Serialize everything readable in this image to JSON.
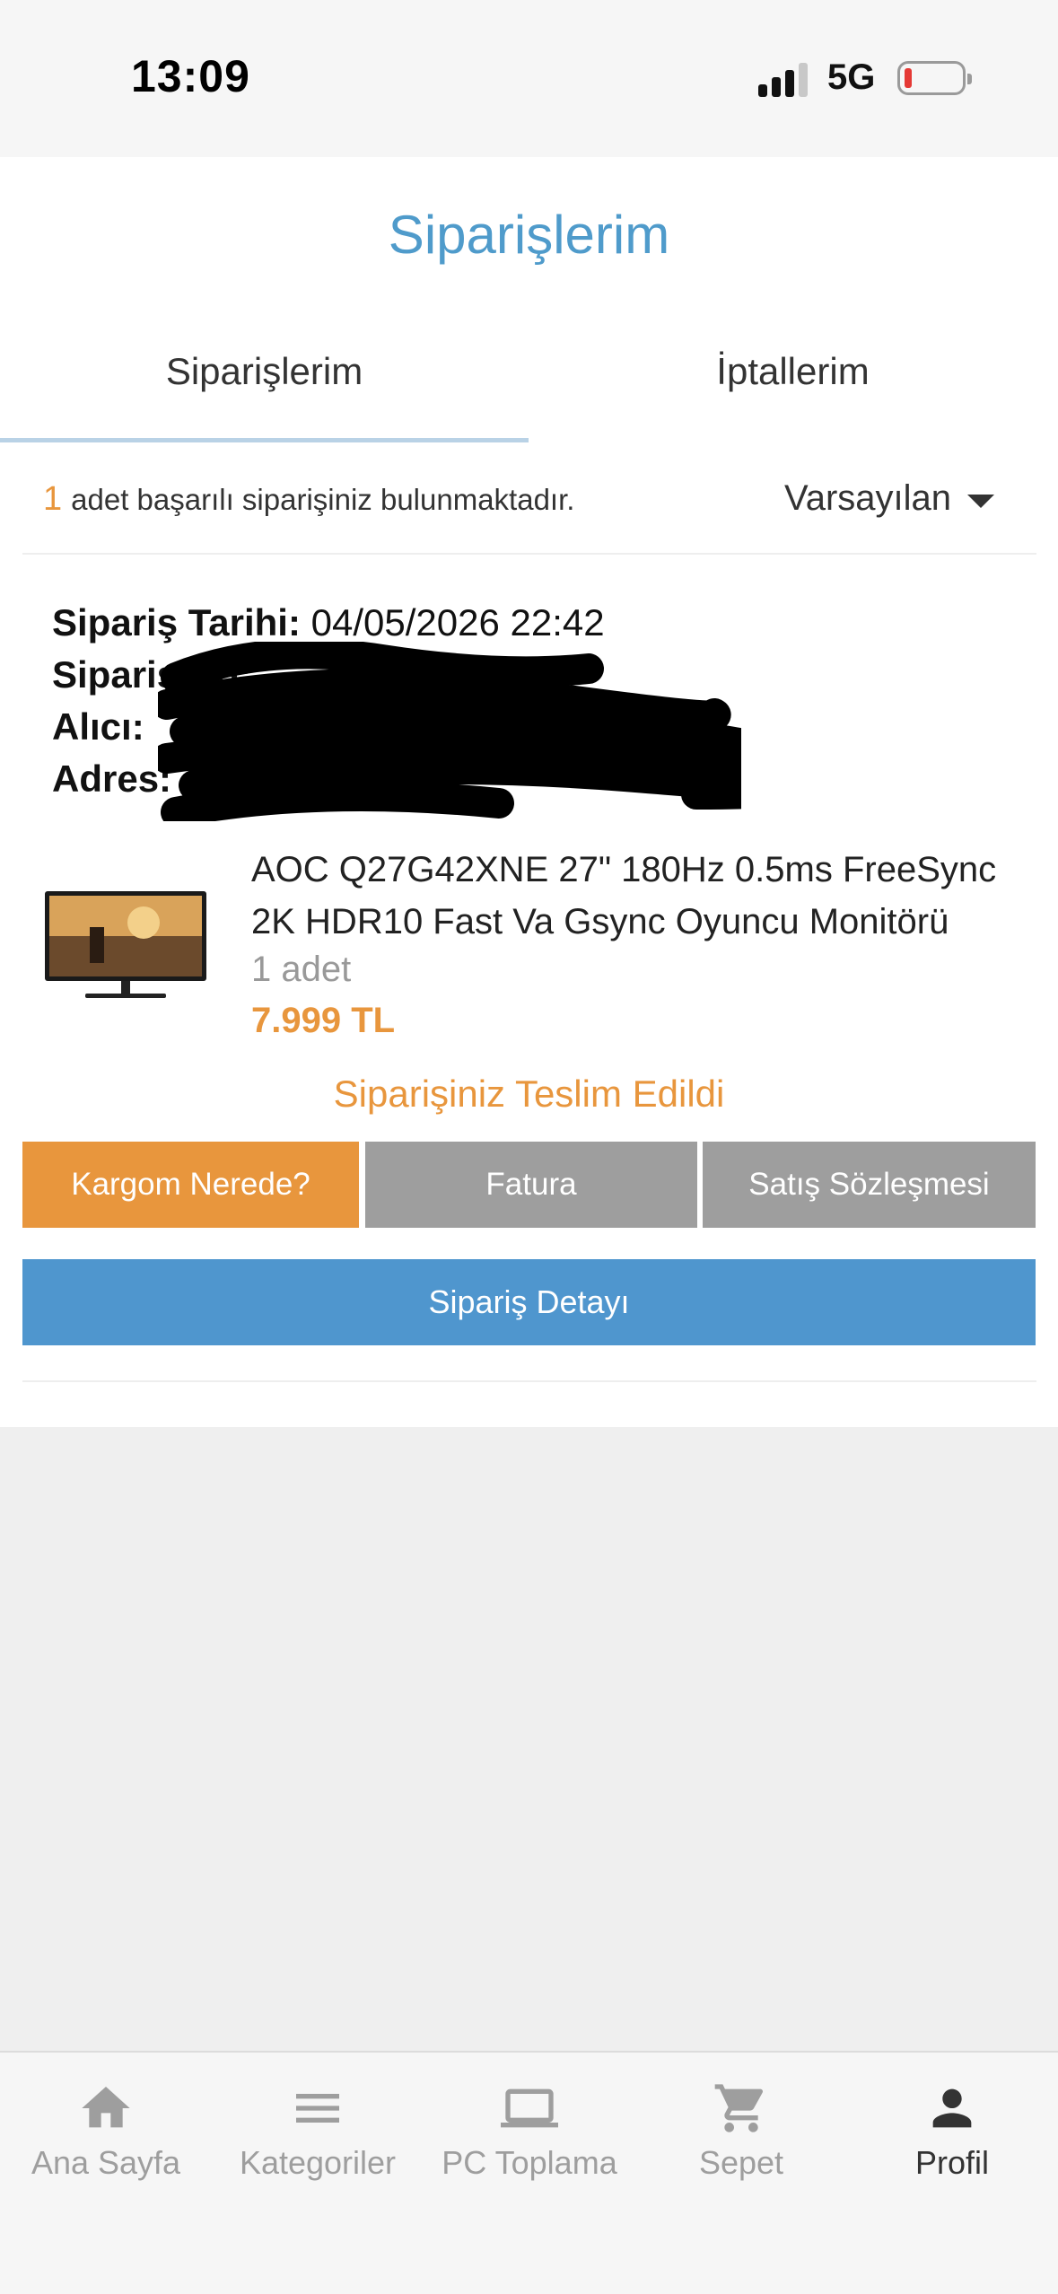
{
  "status_bar": {
    "time": "13:09",
    "network": "5G",
    "battery_level": 0.1
  },
  "page": {
    "title": "Siparişlerim"
  },
  "tabs": [
    {
      "label": "Siparişlerim",
      "active": true
    },
    {
      "label": "İptallerim",
      "active": false
    }
  ],
  "summary": {
    "count": "1",
    "text": "adet başarılı siparişiniz bulunmaktadır."
  },
  "sort": {
    "selected": "Varsayılan"
  },
  "order": {
    "date_label": "Sipariş Tarihi:",
    "date_value": "04/05/2026 22:42",
    "number_label": "Sipariş No:",
    "recipient_label": "Alıcı:",
    "address_label": "Adres:",
    "product": {
      "name": "AOC Q27G42XNE 27\" 180Hz 0.5ms FreeSync 2K HDR10 Fast Va Gsync Oyuncu Monitörü",
      "quantity": "1 adet",
      "price": "7.999 TL"
    },
    "status": "Siparişiniz Teslim Edildi",
    "buttons": {
      "cargo": "Kargom Nerede?",
      "invoice": "Fatura",
      "contract": "Satış Sözleşmesi",
      "detail": "Sipariş Detayı"
    }
  },
  "bottom_nav": [
    {
      "label": "Ana Sayfa",
      "icon": "home-icon"
    },
    {
      "label": "Kategoriler",
      "icon": "menu-icon"
    },
    {
      "label": "PC Toplama",
      "icon": "laptop-icon"
    },
    {
      "label": "Sepet",
      "icon": "cart-icon"
    },
    {
      "label": "Profil",
      "icon": "person-icon",
      "active": true
    }
  ],
  "colors": {
    "accent_orange": "#e8963d",
    "accent_blue": "#4f96ce",
    "title_blue": "#4f9bcb",
    "button_gray": "#9e9e9e"
  }
}
